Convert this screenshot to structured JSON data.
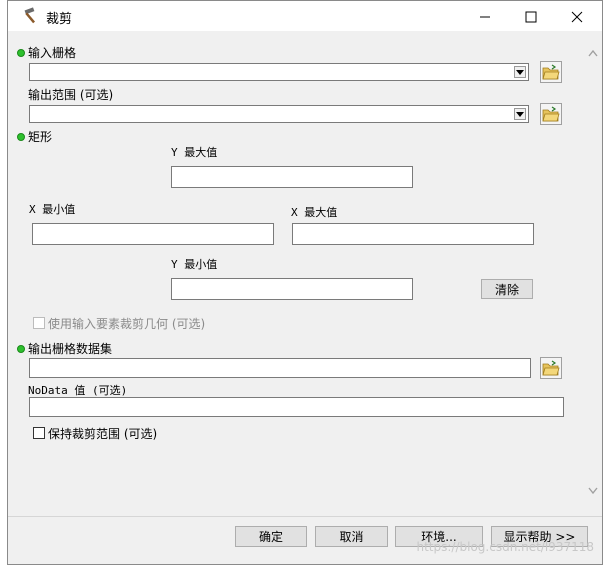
{
  "window": {
    "title": "裁剪",
    "icon": "hammer-icon"
  },
  "params": {
    "input_raster_label": "输入栅格",
    "input_raster_value": "",
    "output_extent_label": "输出范围 (可选)",
    "output_extent_value": "",
    "rectangle_label": "矩形",
    "y_max_label": "Y 最大值",
    "y_max_value": "",
    "x_min_label": "X 最小值",
    "x_min_value": "",
    "x_max_label": "X 最大值",
    "x_max_value": "",
    "y_min_label": "Y 最小值",
    "y_min_value": "",
    "clear_label": "清除",
    "use_features_label": "使用输入要素裁剪几何 (可选)",
    "output_raster_label": "输出栅格数据集",
    "output_raster_value": "",
    "nodata_label": "NoData 值 (可选)",
    "nodata_value": "",
    "maintain_extent_label": "保持裁剪范围 (可选)"
  },
  "footer": {
    "ok": "确定",
    "cancel": "取消",
    "env": "环境...",
    "help": "显示帮助 >>",
    "watermark": "https://blog.csdn.net/l937118"
  },
  "colors": {
    "required_bullet": "#2ec02e",
    "dialog_bg": "#f0f0f0"
  }
}
